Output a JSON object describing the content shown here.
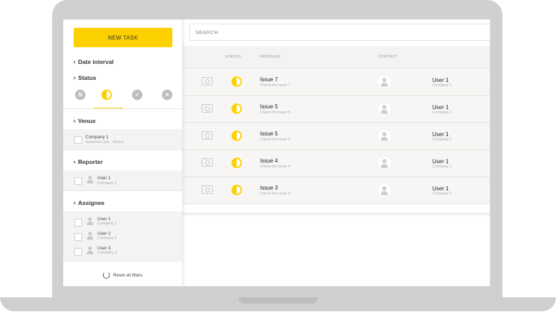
{
  "sidebar": {
    "new_task_label": "NEW TASK",
    "sections": {
      "date_interval": "Date interval",
      "status": "Status",
      "venue": "Venue",
      "reporter": "Reporter",
      "assignee": "Assignee"
    },
    "status_filters": [
      {
        "icon": "n-status-icon",
        "glyph": "N"
      },
      {
        "icon": "half-circle-status-icon",
        "glyph": ""
      },
      {
        "icon": "check-status-icon",
        "glyph": "✓"
      },
      {
        "icon": "x-status-icon",
        "glyph": "✕"
      }
    ],
    "venue_items": [
      {
        "name": "Company 1",
        "sub": "Gedimino ave., Vilnius"
      }
    ],
    "reporter_items": [
      {
        "name": "User 1",
        "sub": "Company 1"
      }
    ],
    "assignee_items": [
      {
        "name": "User 1",
        "sub": "Company 1"
      },
      {
        "name": "User 2",
        "sub": "Company 2"
      },
      {
        "name": "User 3",
        "sub": "Company 3"
      }
    ],
    "reset_label": "Reset all filters"
  },
  "search": {
    "placeholder": "SEARCH"
  },
  "table": {
    "headers": {
      "status": "STATUS",
      "problem": "PROBLEM",
      "contact": "CONTACT"
    },
    "rows": [
      {
        "title": "Issue 7",
        "sub": "Check the issue 7",
        "user": "User 1",
        "company": "Company 1"
      },
      {
        "title": "Issue 5",
        "sub": "Check the issue 5",
        "user": "User 1",
        "company": "Company 1"
      },
      {
        "title": "Issue 5",
        "sub": "Check the issue 5",
        "user": "User 1",
        "company": "Company 1"
      },
      {
        "title": "Issue 4",
        "sub": "Check the issue 4",
        "user": "User 1",
        "company": "Company 1"
      },
      {
        "title": "Issue 3",
        "sub": "Check the issue 3",
        "user": "User 1",
        "company": "Company 1"
      }
    ]
  },
  "colors": {
    "accent": "#fdd100",
    "row_bg": "#f7f6f4",
    "device": "#d0d0d0"
  }
}
